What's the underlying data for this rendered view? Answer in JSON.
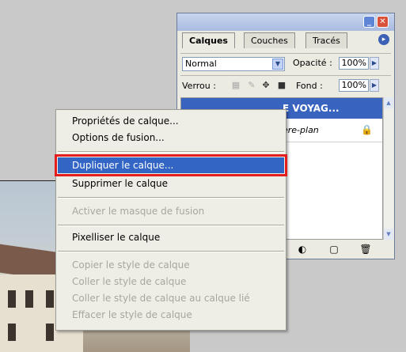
{
  "panel": {
    "tabs": [
      "Calques",
      "Couches",
      "Tracés"
    ],
    "blend_mode": "Normal",
    "opacity_label": "Opacité :",
    "opacity_value": "100%",
    "lock_label": "Verrou :",
    "fill_label": "Fond :",
    "fill_value": "100%",
    "layers": [
      {
        "name": "E VOYAG...",
        "selected": true
      },
      {
        "name": "ère-plan",
        "locked": true
      }
    ],
    "colors": {
      "selection": "#3863bf",
      "titlebar": "#a9bbe0"
    }
  },
  "context_menu": {
    "items": [
      {
        "label": "Propriétés de calque...",
        "enabled": true
      },
      {
        "label": "Options de fusion...",
        "enabled": true
      },
      {
        "label": "Dupliquer le calque...",
        "enabled": true,
        "selected": true
      },
      {
        "label": "Supprimer le calque",
        "enabled": true
      },
      {
        "label": "Activer le masque de fusion",
        "enabled": false
      },
      {
        "label": "Pixelliser le calque",
        "enabled": true
      },
      {
        "label": "Copier le style de calque",
        "enabled": false
      },
      {
        "label": "Coller le style de calque",
        "enabled": false
      },
      {
        "label": "Coller le style de calque au calque lié",
        "enabled": false
      },
      {
        "label": "Effacer le style de calque",
        "enabled": false
      }
    ],
    "highlight_color": "#3265c4",
    "annotation_color": "#e31c1c"
  }
}
